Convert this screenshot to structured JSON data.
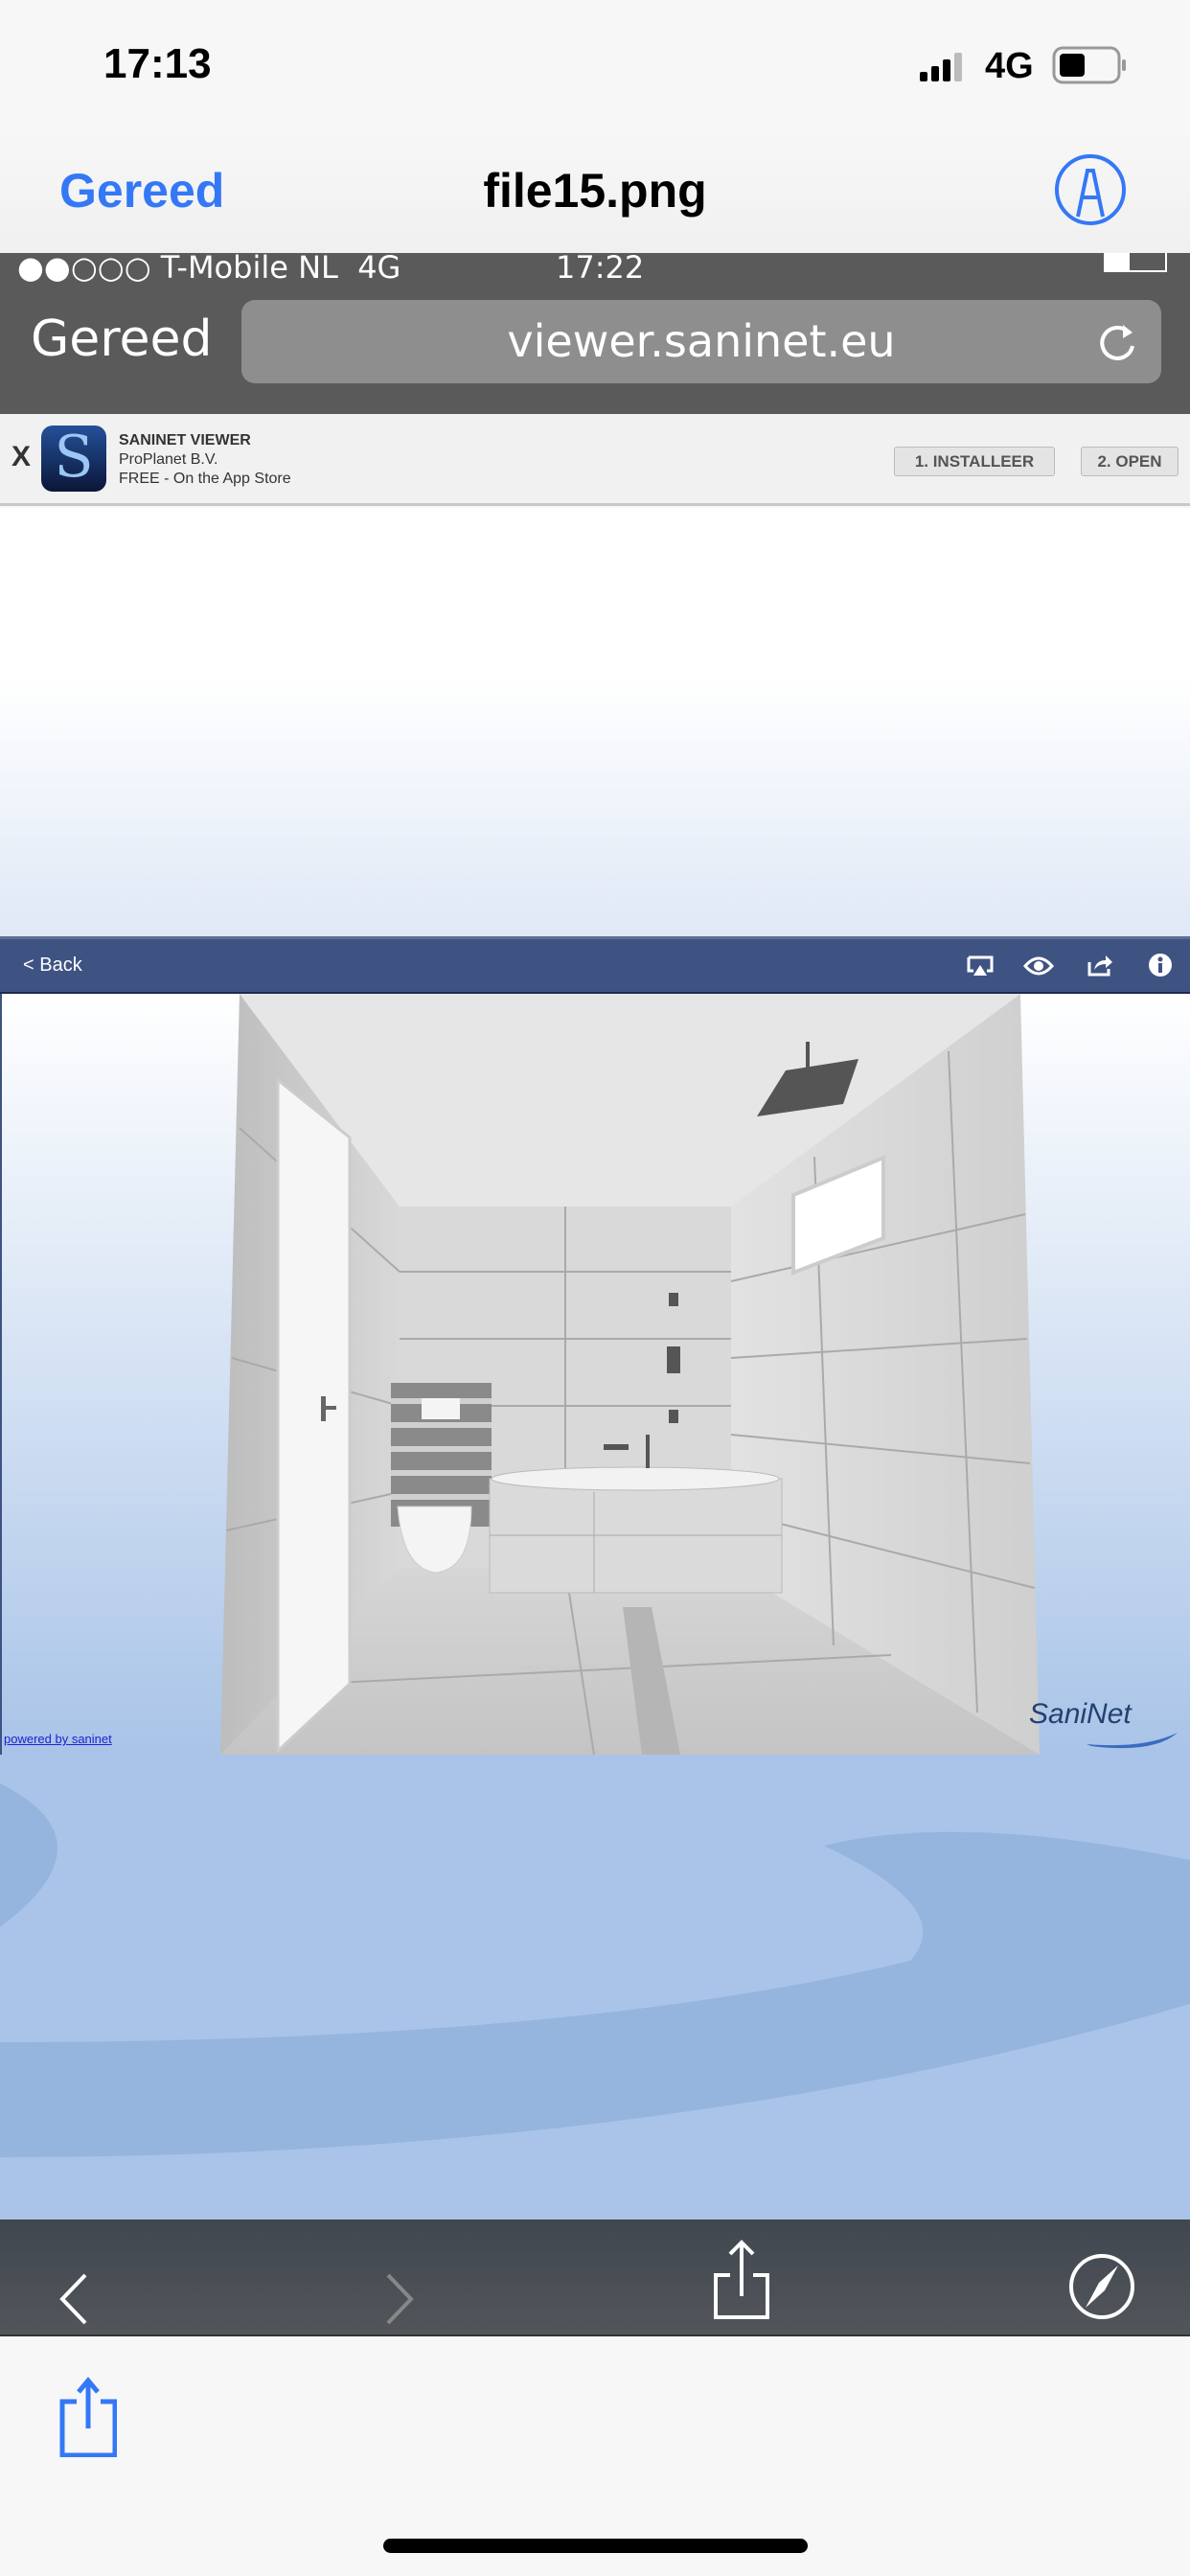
{
  "ios_status": {
    "time": "17:13",
    "network": "4G"
  },
  "title_bar": {
    "done_label": "Gereed",
    "file_name": "file15.png"
  },
  "inner_browser": {
    "status": {
      "carrier": "T-Mobile NL",
      "network": "4G",
      "time": "17:22"
    },
    "done_label": "Gereed",
    "url": "viewer.saninet.eu"
  },
  "app_banner": {
    "close": "X",
    "app_name": "SANINET VIEWER",
    "publisher": "ProPlanet B.V.",
    "price": "FREE - On the App Store",
    "install_label": "1. INSTALLEER",
    "open_label": "2. OPEN"
  },
  "viewer": {
    "back_label": "< Back",
    "powered_by": "powered by saninet",
    "logo": "SaniNet"
  },
  "colors": {
    "accent": "#3478f6",
    "viewer_header": "#3f5383",
    "background_blue": "#95b4de"
  }
}
